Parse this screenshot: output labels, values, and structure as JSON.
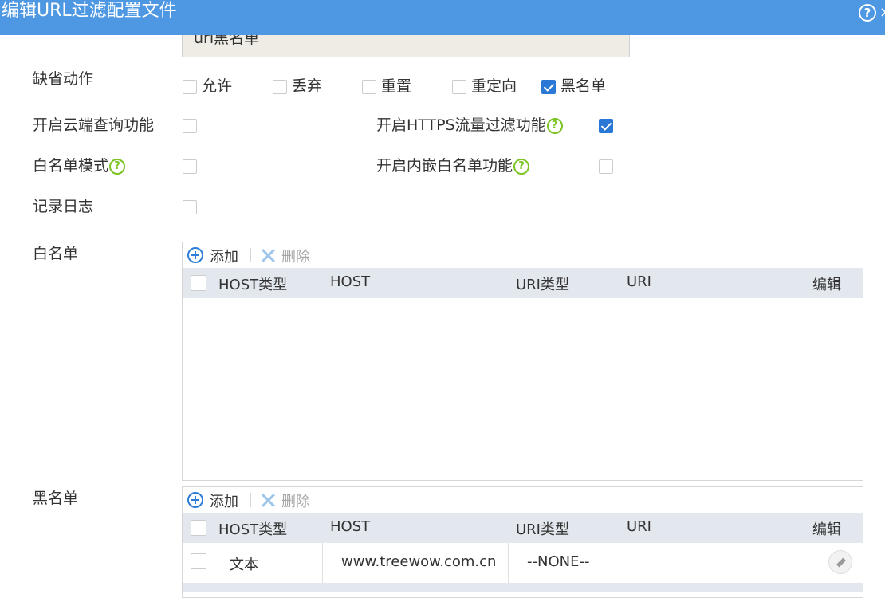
{
  "window": {
    "title": "编辑URL过滤配置文件",
    "close_glyph": "×"
  },
  "name_field": {
    "value": "url黑名单"
  },
  "default_action": {
    "label": "缺省动作",
    "options": [
      {
        "label": "允许",
        "checked": false
      },
      {
        "label": "丢弃",
        "checked": false
      },
      {
        "label": "重置",
        "checked": false
      },
      {
        "label": "重定向",
        "checked": false
      },
      {
        "label": "黑名单",
        "checked": true
      }
    ]
  },
  "settings": {
    "cloud_query": {
      "label": "开启云端查询功能",
      "checked": false
    },
    "https_filter": {
      "label": "开启HTTPS流量过滤功能",
      "checked": true
    },
    "whitelist_mode": {
      "label": "白名单模式",
      "checked": false
    },
    "embedded_whitelist": {
      "label": "开启内嵌白名单功能",
      "checked": false
    },
    "log": {
      "label": "记录日志",
      "checked": false
    }
  },
  "whitelist": {
    "label": "白名单",
    "add_label": "添加",
    "delete_label": "删除",
    "columns": [
      "HOST类型",
      "HOST",
      "URI类型",
      "URI",
      "编辑"
    ],
    "rows": []
  },
  "blacklist": {
    "label": "黑名单",
    "add_label": "添加",
    "delete_label": "删除",
    "columns": [
      "HOST类型",
      "HOST",
      "URI类型",
      "URI",
      "编辑"
    ],
    "rows": [
      {
        "host_type": "文本",
        "host": "www.treewow.com.cn",
        "uri_type": "--NONE--",
        "uri": ""
      }
    ]
  },
  "colors": {
    "titlebar": "#4d97e3",
    "checkbox_on": "#2b77d5",
    "help_icon": "#7cc424",
    "grid_header": "#e3e8ef"
  }
}
